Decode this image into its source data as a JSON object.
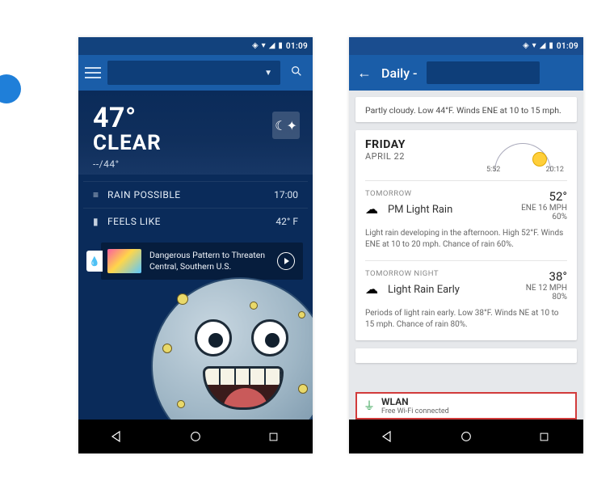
{
  "status": {
    "time": "01:09",
    "icons": [
      "◈",
      "▾",
      "⧗",
      "◧",
      "▮"
    ]
  },
  "left": {
    "temperature": "47°",
    "condition": "CLEAR",
    "hilo": "--/44°",
    "rows": [
      {
        "icon": "≡",
        "label": "RAIN POSSIBLE",
        "value": "17:00"
      },
      {
        "icon": "▮",
        "label": "FEELS LIKE",
        "value": "42° F"
      }
    ],
    "news": {
      "headline": "Dangerous Pattern to Threaten Central, Southern U.S."
    }
  },
  "right": {
    "title": "Daily -",
    "top_summary": "Partly cloudy. Low 44°F. Winds ENE at 10 to 15 mph.",
    "day": {
      "name": "FRIDAY",
      "date": "APRIL 22",
      "sunrise": "5:52",
      "sunset": "20:12"
    },
    "forecasts": [
      {
        "label": "TOMORROW",
        "name": "PM Light Rain",
        "hi": "52°",
        "wind": "ENE 16 MPH",
        "chance": "60%",
        "desc": "Light rain developing in the afternoon. High 52°F. Winds ENE at 10 to 20 mph. Chance of rain 60%."
      },
      {
        "label": "TOMORROW NIGHT",
        "name": "Light Rain Early",
        "hi": "38°",
        "wind": "NE 12 MPH",
        "chance": "80%",
        "desc": "Periods of light rain early. Low 38°F. Winds NE at 10 to 15 mph. Chance of rain 80%."
      }
    ],
    "wlan": {
      "title": "WLAN",
      "sub": "Free  Wi-Fi  connected"
    }
  }
}
